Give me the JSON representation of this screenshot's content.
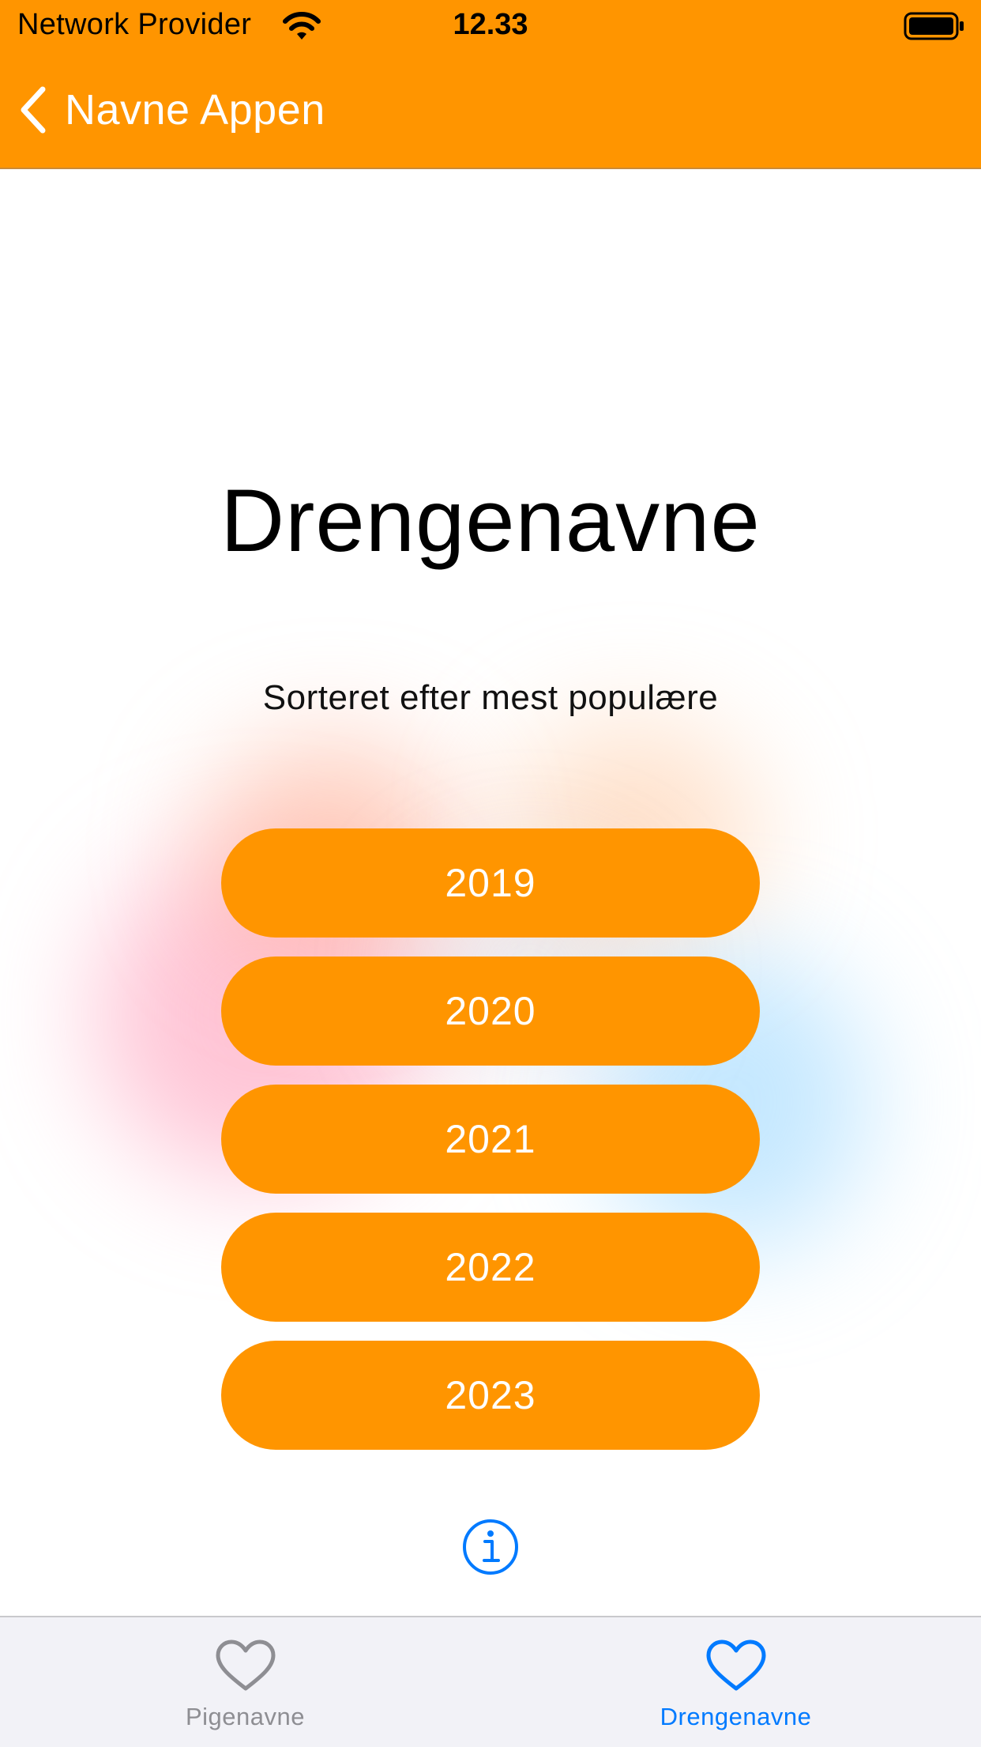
{
  "status_bar": {
    "carrier": "Network Provider",
    "time": "12.33"
  },
  "nav": {
    "back_label": "Navne Appen"
  },
  "main": {
    "title": "Drengenavne",
    "subtitle": "Sorteret efter mest populære",
    "year_buttons": [
      "2019",
      "2020",
      "2021",
      "2022",
      "2023"
    ]
  },
  "tab_bar": {
    "tabs": [
      {
        "label": "Pigenavne",
        "icon": "heart-outline-icon",
        "selected": false
      },
      {
        "label": "Drengenavne",
        "icon": "heart-outline-icon",
        "selected": true
      }
    ]
  },
  "colors": {
    "accent": "#FF9500",
    "tint": "#007AFF",
    "inactive": "#8e8e93"
  }
}
